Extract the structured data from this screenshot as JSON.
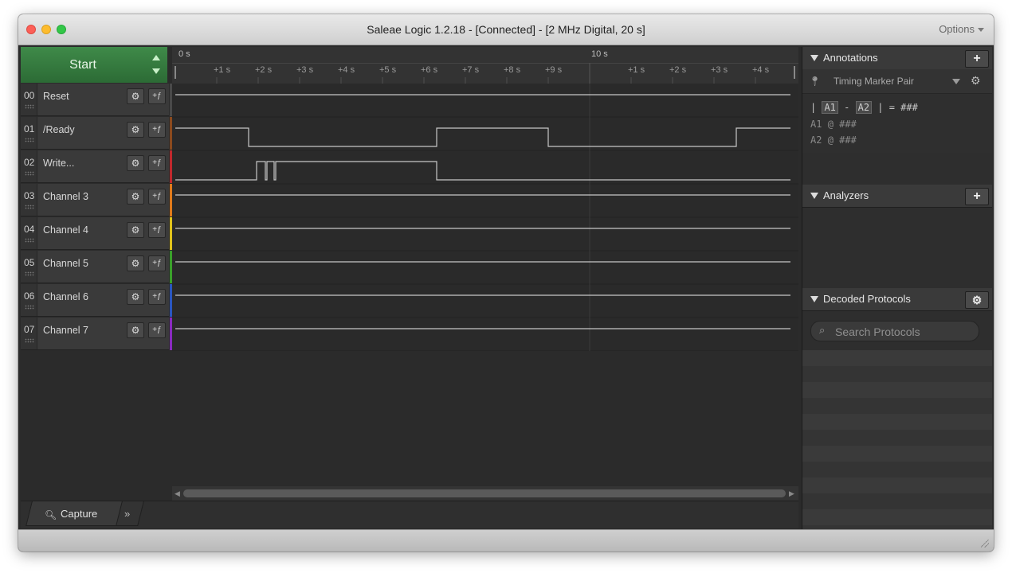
{
  "window": {
    "title": "Saleae Logic 1.2.18 - [Connected] - [2 MHz Digital, 20 s]",
    "options_label": "Options"
  },
  "start_button": {
    "label": "Start"
  },
  "channels": [
    {
      "num": "00",
      "name": "Reset",
      "color": "#4a4a4a"
    },
    {
      "num": "01",
      "name": "/Ready",
      "color": "#8b4a1e"
    },
    {
      "num": "02",
      "name": "Write...",
      "color": "#c0282d"
    },
    {
      "num": "03",
      "name": "Channel 3",
      "color": "#e07a1b"
    },
    {
      "num": "04",
      "name": "Channel 4",
      "color": "#e0c21b"
    },
    {
      "num": "05",
      "name": "Channel 5",
      "color": "#3aa02a"
    },
    {
      "num": "06",
      "name": "Channel 6",
      "color": "#2a56c0"
    },
    {
      "num": "07",
      "name": "Channel 7",
      "color": "#8a2ac0"
    }
  ],
  "ruler": {
    "major": [
      "0 s",
      "10 s"
    ],
    "ticks": [
      "+1 s",
      "+2 s",
      "+3 s",
      "+4 s",
      "+5 s",
      "+6 s",
      "+7 s",
      "+8 s",
      "+9 s",
      "+1 s",
      "+2 s",
      "+3 s",
      "+4 s"
    ]
  },
  "capture_tab": {
    "label": "Capture"
  },
  "annotations": {
    "title": "Annotations",
    "marker_pair_label": "Timing Marker Pair",
    "a1": "A1",
    "a2": "A2",
    "eq": "= ###",
    "a1_line": "@ ###",
    "a2_line": "@ ###"
  },
  "analyzers": {
    "title": "Analyzers"
  },
  "decoded_protocols": {
    "title": "Decoded Protocols",
    "search_placeholder": "Search Protocols"
  },
  "icons": {
    "add": "plus-icon",
    "settings": "gear-icon",
    "trigger": "trigger-icon",
    "search": "search-icon"
  }
}
